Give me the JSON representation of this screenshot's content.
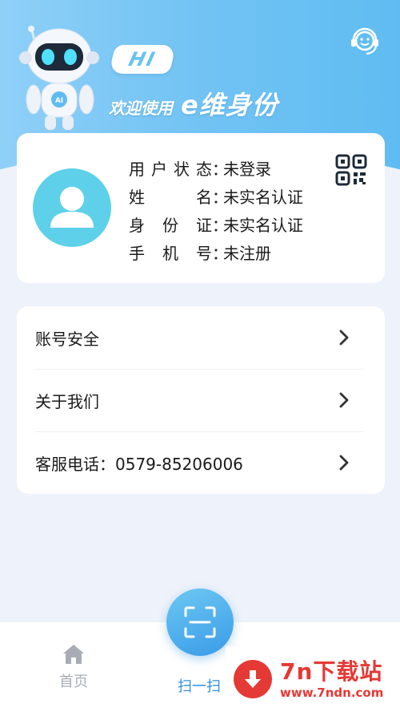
{
  "header": {
    "hi_text": "HI",
    "welcome_text": "欢迎使用",
    "app_name": "e维身份",
    "robot_badge": "AI",
    "service_icon": "customer-service-icon"
  },
  "profile": {
    "qr_icon": "qr-code-icon",
    "rows": [
      {
        "label_chars": [
          "用",
          "户",
          "状",
          "态"
        ],
        "value": "未登录"
      },
      {
        "label_chars": [
          "姓",
          "名"
        ],
        "value": "未实名认证"
      },
      {
        "label_chars": [
          "身",
          "份",
          "证"
        ],
        "value": "未实名认证"
      },
      {
        "label_chars": [
          "手",
          "机",
          "号"
        ],
        "value": "未注册"
      }
    ],
    "colon": "："
  },
  "menu": {
    "items": [
      {
        "label": "账号安全"
      },
      {
        "label": "关于我们"
      },
      {
        "label": "客服电话：0579-85206006"
      }
    ]
  },
  "tabbar": {
    "home_label": "首页",
    "scan_label": "扫一扫",
    "active_color": "#2f8fe6",
    "inactive_color": "#a8adb5"
  },
  "watermark": {
    "title": "7n下载站",
    "url": "www.7ndn.com"
  }
}
